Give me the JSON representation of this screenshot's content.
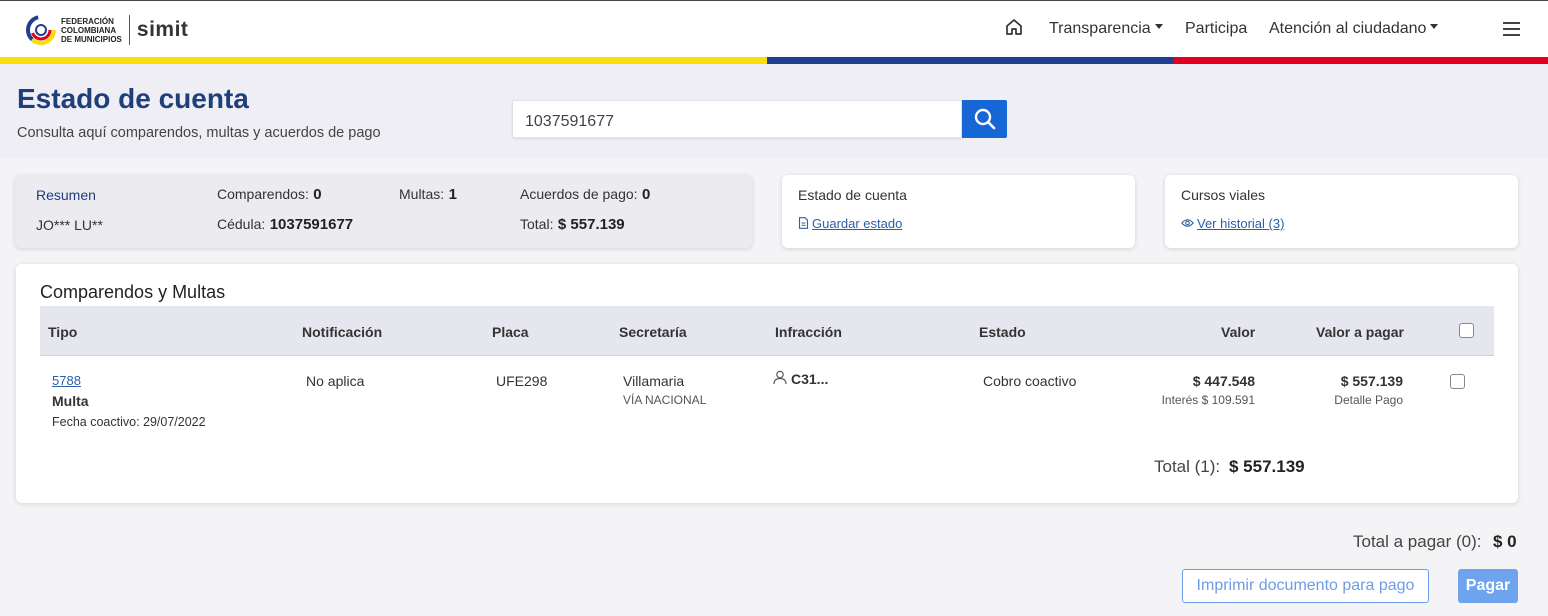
{
  "header": {
    "logo": {
      "federation_lines": [
        "FEDERACIÓN",
        "COLOMBIANA",
        "DE MUNICIPIOS"
      ],
      "brand": "simit"
    },
    "nav": {
      "transparencia": "Transparencia",
      "participa": "Participa",
      "atencion": "Atención al ciudadano"
    },
    "icons": {
      "home": "home-icon",
      "menu": "hamburger-menu-icon"
    }
  },
  "flag_colors": {
    "yellow": "#fcdd09",
    "blue": "#213f8f",
    "red": "#e1001f"
  },
  "hero": {
    "title": "Estado de cuenta",
    "subtitle": "Consulta aquí comparendos, multas y acuerdos de pago",
    "search_value": "1037591677",
    "search_icon": "search-icon"
  },
  "resumen": {
    "title": "Resumen",
    "name": "JO*** LU**",
    "comparendos_label": "Comparendos:",
    "comparendos_value": "0",
    "multas_label": "Multas:",
    "multas_value": "1",
    "acuerdos_label": "Acuerdos de pago:",
    "acuerdos_value": "0",
    "cedula_label": "Cédula:",
    "cedula_value": "1037591677",
    "total_label": "Total:",
    "total_value": "$ 557.139"
  },
  "estado_card": {
    "title": "Estado de cuenta",
    "link": "Guardar estado"
  },
  "cursos_card": {
    "title": "Cursos viales",
    "link": "Ver historial (3)"
  },
  "table": {
    "title": "Comparendos y Multas",
    "headers": [
      "Tipo",
      "Notificación",
      "Placa",
      "Secretaría",
      "Infracción",
      "Estado",
      "Valor",
      "Valor a pagar"
    ],
    "row": {
      "id_link": "5788",
      "tipo": "Multa",
      "fecha": "Fecha coactivo: 29/07/2022",
      "notificacion": "No aplica",
      "placa": "UFE298",
      "secretaria": "Villamaria",
      "secretaria_sub": "VÍA NACIONAL",
      "infraccion": "C31...",
      "estado": "Cobro coactivo",
      "valor": "$ 447.548",
      "interes": "Interés $ 109.591",
      "valor_pagar": "$ 557.139",
      "detalle": "Detalle Pago"
    },
    "total_label": "Total (1):",
    "total_value": "$ 557.139"
  },
  "footer": {
    "total_pagar_label": "Total a pagar (0):",
    "total_pagar_value": "$ 0",
    "print_button": "Imprimir documento para pago",
    "pay_button": "Pagar"
  }
}
